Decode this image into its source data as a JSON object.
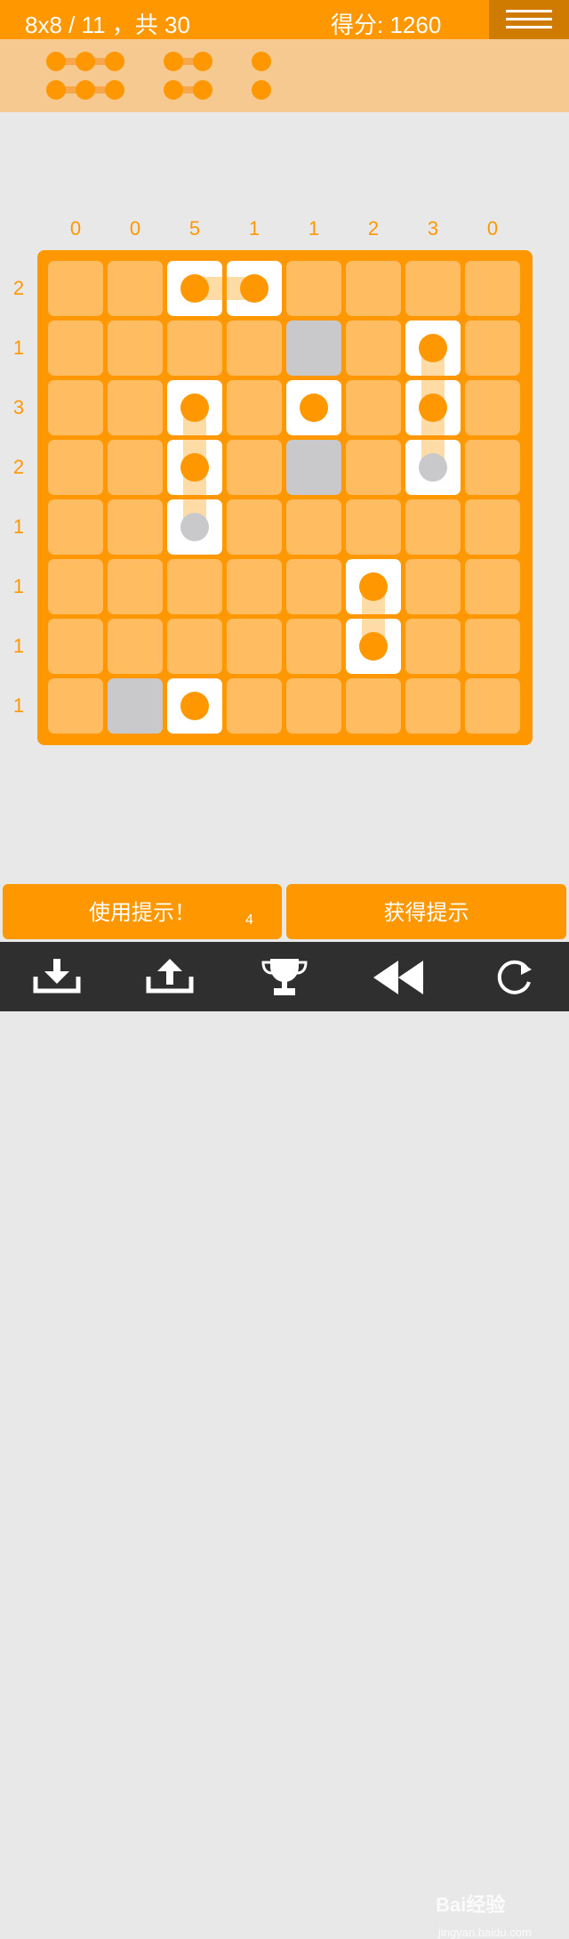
{
  "header": {
    "level_text": "8x8 / 11 ，共 30",
    "score_text": "得分: 1260"
  },
  "legend": {
    "ships": [
      {
        "size": 3,
        "count": 2
      },
      {
        "size": 2,
        "count": 2
      },
      {
        "size": 1,
        "count": 2
      }
    ]
  },
  "hints": {
    "columns": [
      "0",
      "0",
      "5",
      "1",
      "1",
      "2",
      "3",
      "0"
    ],
    "rows": [
      "2",
      "1",
      "3",
      "2",
      "1",
      "1",
      "1",
      "1"
    ]
  },
  "board": {
    "size": 8,
    "cells": [
      {
        "r": 0,
        "c": 2,
        "state": "ship"
      },
      {
        "r": 0,
        "c": 3,
        "state": "ship"
      },
      {
        "r": 1,
        "c": 4,
        "state": "empty"
      },
      {
        "r": 1,
        "c": 6,
        "state": "ship"
      },
      {
        "r": 2,
        "c": 2,
        "state": "ship"
      },
      {
        "r": 2,
        "c": 4,
        "state": "ship"
      },
      {
        "r": 2,
        "c": 6,
        "state": "ship"
      },
      {
        "r": 3,
        "c": 2,
        "state": "ship"
      },
      {
        "r": 3,
        "c": 4,
        "state": "empty"
      },
      {
        "r": 3,
        "c": 6,
        "state": "ship-gray"
      },
      {
        "r": 4,
        "c": 2,
        "state": "ship-gray"
      },
      {
        "r": 5,
        "c": 5,
        "state": "ship"
      },
      {
        "r": 6,
        "c": 5,
        "state": "ship"
      },
      {
        "r": 7,
        "c": 1,
        "state": "empty"
      },
      {
        "r": 7,
        "c": 2,
        "state": "ship"
      }
    ],
    "connections": [
      {
        "r1": 0,
        "c1": 2,
        "r2": 0,
        "c2": 3
      },
      {
        "r1": 1,
        "c1": 6,
        "r2": 3,
        "c2": 6
      },
      {
        "r1": 2,
        "c1": 2,
        "r2": 4,
        "c2": 2
      },
      {
        "r1": 5,
        "c1": 5,
        "r2": 6,
        "c2": 5
      }
    ]
  },
  "buttons": {
    "use_hint": "使用提示！",
    "use_hint_count": "4",
    "get_hint": "获得提示"
  },
  "toolbar": {
    "items": [
      "download-icon",
      "upload-icon",
      "trophy-icon",
      "rewind-icon",
      "restart-icon"
    ],
    "watermark": "Bai经验",
    "watermark_url": "jingyan.baidu.com"
  },
  "colors": {
    "accent": "#ff9800",
    "cell": "#ffbc61",
    "empty": "#c9c9cc",
    "ship": "#ffffff"
  }
}
